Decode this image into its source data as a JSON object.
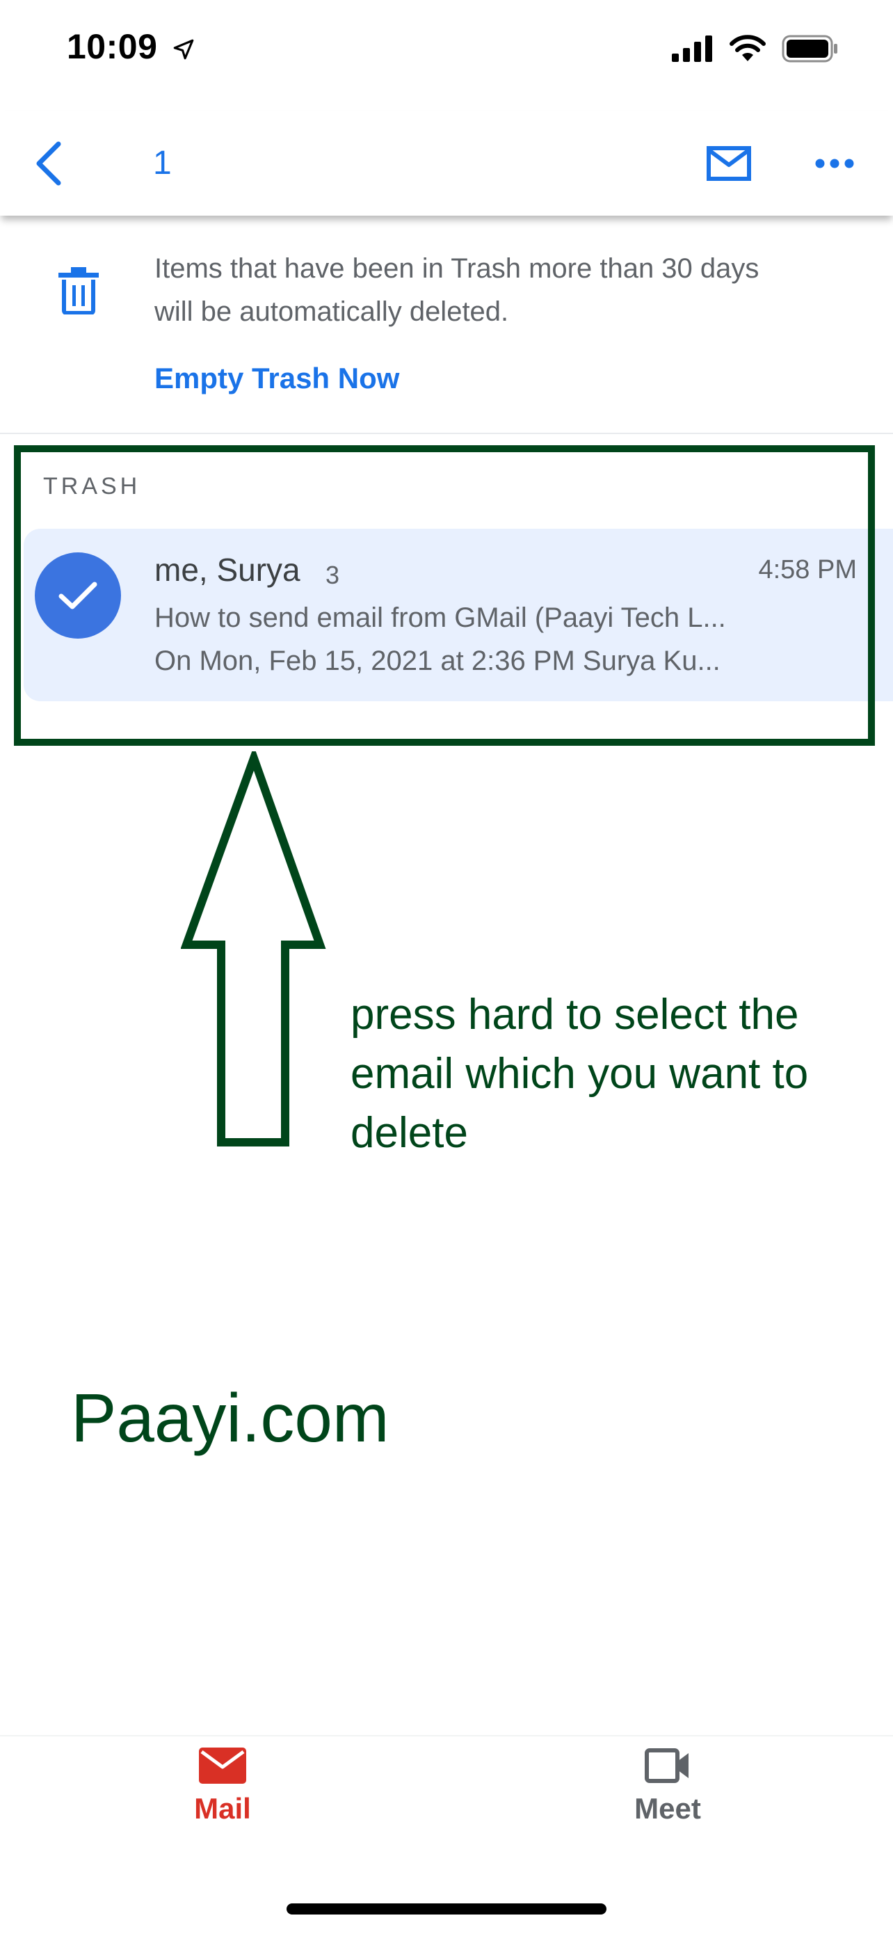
{
  "status_bar": {
    "time": "10:09"
  },
  "header": {
    "count": "1"
  },
  "trash_notice": {
    "line1": "Items that have been in Trash more than 30 days",
    "line2": "will be automatically deleted.",
    "action": "Empty Trash Now"
  },
  "section": {
    "label": "TRASH"
  },
  "email": {
    "sender": "me, Surya",
    "thread_count": "3",
    "time": "4:58 PM",
    "subject": "How to send email from GMail (Paayi Tech L...",
    "snippet": "On Mon, Feb 15, 2021 at 2:36 PM Surya Ku..."
  },
  "annotation": {
    "line1": "press hard to select the",
    "line2": "email which you want to",
    "line3": "delete"
  },
  "watermark": "Paayi.com",
  "bottom_nav": {
    "mail": "Mail",
    "meet": "Meet"
  },
  "colors": {
    "accent": "#1a73e8",
    "mail_red": "#d93025",
    "annotation_green": "#00451a",
    "selected_row": "#e8f0fe"
  },
  "icons": [
    "location-arrow-icon",
    "signal-icon",
    "wifi-icon",
    "battery-icon",
    "back-chevron-icon",
    "mail-icon",
    "more-icon",
    "trash-icon",
    "check-icon",
    "mail-tab-icon",
    "video-camera-icon"
  ]
}
